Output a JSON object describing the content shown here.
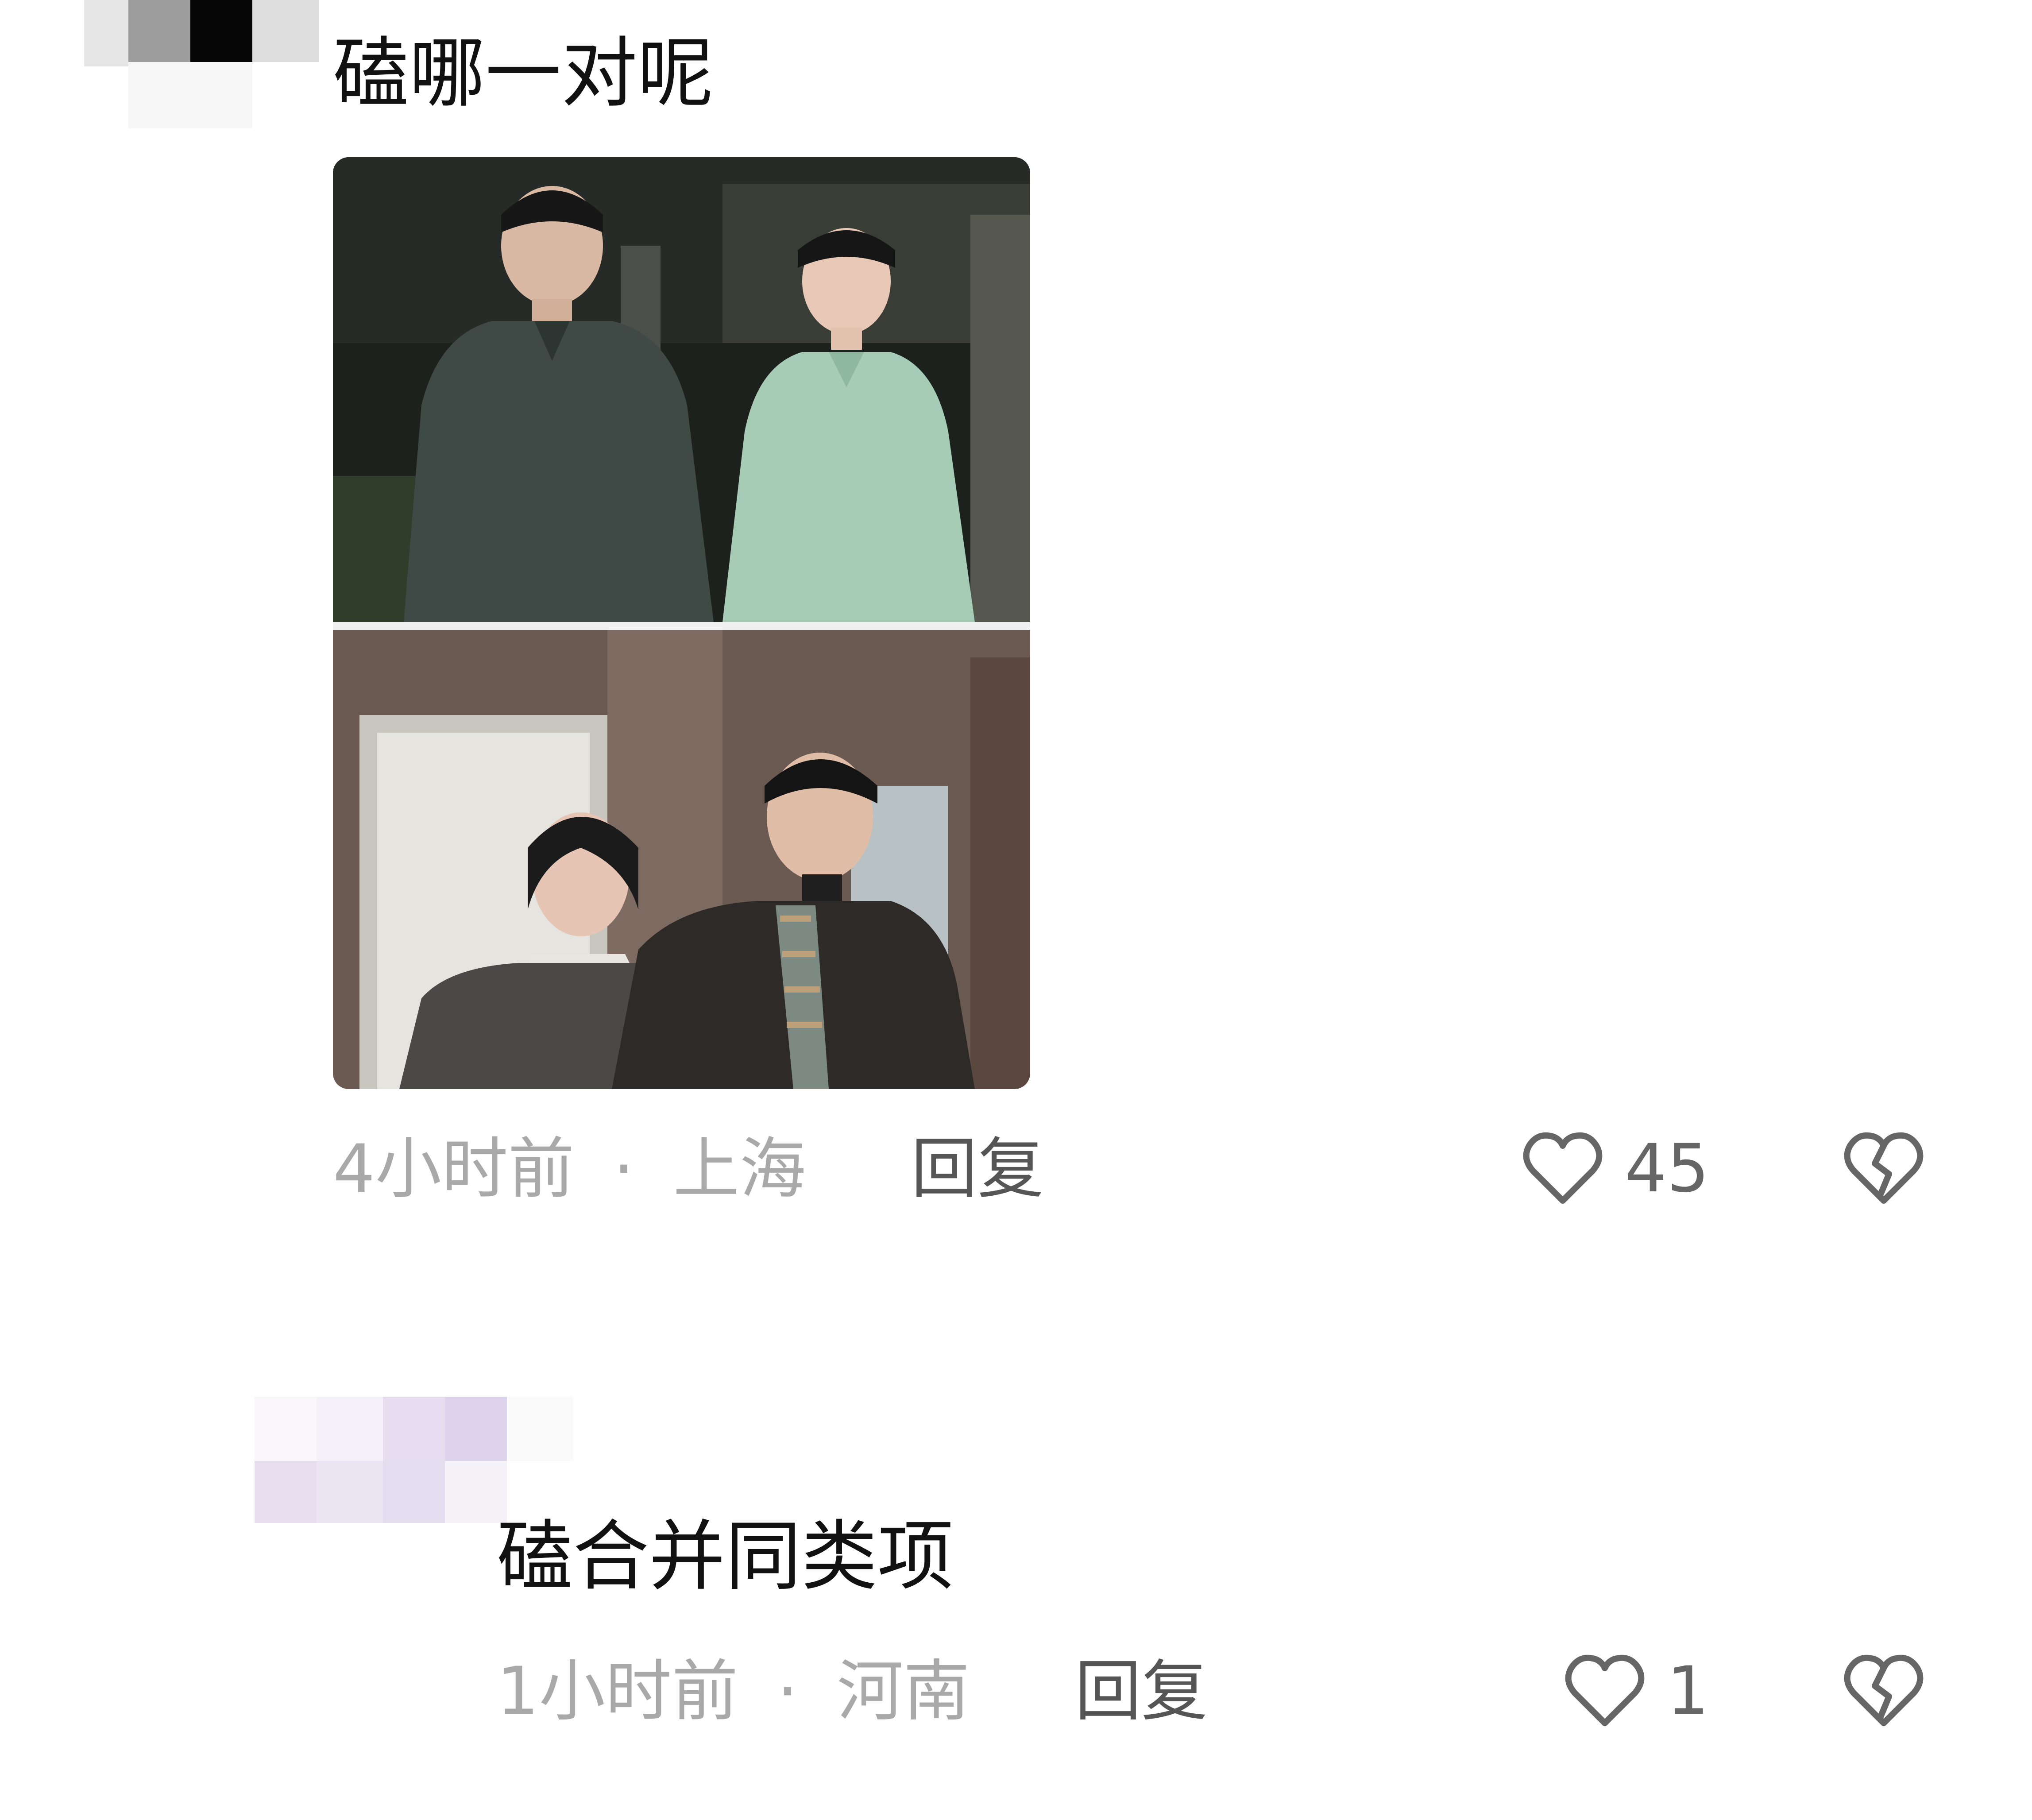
{
  "comments": [
    {
      "text": "磕哪一对呢",
      "time": "4小时前",
      "separator": "·",
      "location": "上海",
      "reply_label": "回复",
      "like_count": "45",
      "has_image": true,
      "image_panels": [
        "photo-top-couple",
        "photo-bottom-couple"
      ]
    },
    {
      "text": "磕合并同类项",
      "time": "1小时前",
      "separator": "·",
      "location": "河南",
      "reply_label": "回复",
      "like_count": "1",
      "has_image": false
    }
  ],
  "icons": {
    "like": "heart-icon",
    "dislike": "broken-heart-icon"
  },
  "colors": {
    "background": "#ffffff",
    "text_primary": "#111111",
    "text_meta": "#a9a9a9",
    "text_reply": "#555555",
    "icon_stroke": "#666666"
  }
}
